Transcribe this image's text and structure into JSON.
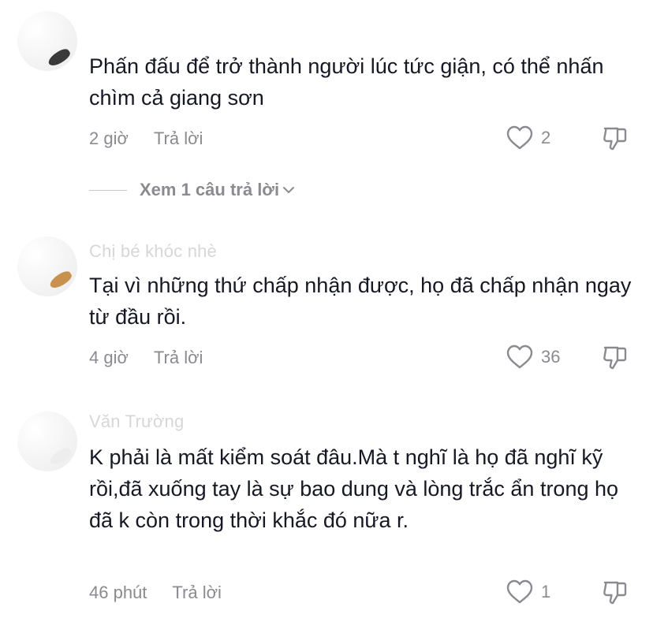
{
  "comments": [
    {
      "author": "",
      "text": "Phấn đấu để trở thành người lúc tức giận, có thể nhấn chìm cả giang sơn",
      "time": "2 giờ",
      "reply_label": "Trả lời",
      "likes": "2",
      "view_replies": "Xem 1 câu trả lời"
    },
    {
      "author": "Chị bé khóc nhè",
      "text": "Tại vì những thứ chấp nhận được, họ đã chấp nhận ngay từ đầu rồi.",
      "time": "4 giờ",
      "reply_label": "Trả lời",
      "likes": "36"
    },
    {
      "author": "Văn Trường",
      "text": "K phải là mất kiểm soát đâu.Mà t nghĩ là họ đã nghĩ kỹ rồi,đã xuống tay là sự bao dung và lòng trắc ẩn trong họ đã k còn trong thời khắc đó nữa r.",
      "time": "46 phút",
      "reply_label": "Trả lời",
      "likes": "1"
    }
  ],
  "icons": {
    "like": "heart-outline-icon",
    "dislike": "thumbs-down-outline-icon",
    "expand": "chevron-down-icon"
  },
  "colors": {
    "text": "#161823",
    "secondary": "#8a8b91",
    "author": "#d7d7d9",
    "background": "#ffffff"
  }
}
